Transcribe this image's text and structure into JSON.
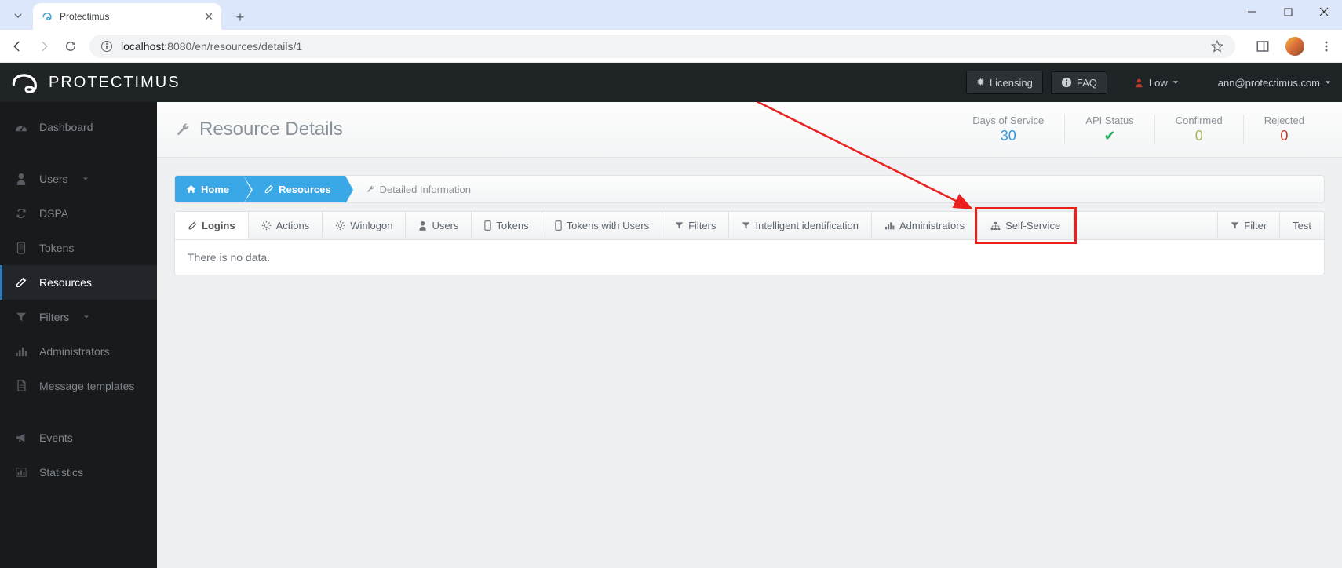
{
  "browser": {
    "tab_title": "Protectimus",
    "url_host": "localhost",
    "url_port": ":8080",
    "url_path": "/en/resources/details/1"
  },
  "topnav": {
    "brand": "PROTECTIMUS",
    "licensing": "Licensing",
    "faq": "FAQ",
    "status_label": "Low",
    "user_email": "ann@protectimus.com"
  },
  "sidebar": {
    "items": [
      {
        "label": "Dashboard"
      },
      {
        "label": "Users"
      },
      {
        "label": "DSPA"
      },
      {
        "label": "Tokens"
      },
      {
        "label": "Resources"
      },
      {
        "label": "Filters"
      },
      {
        "label": "Administrators"
      },
      {
        "label": "Message templates"
      },
      {
        "label": "Events"
      },
      {
        "label": "Statistics"
      }
    ]
  },
  "page": {
    "title": "Resource Details",
    "stats": {
      "days_label": "Days of Service",
      "days_value": "30",
      "api_label": "API Status",
      "confirmed_label": "Confirmed",
      "confirmed_value": "0",
      "rejected_label": "Rejected",
      "rejected_value": "0"
    }
  },
  "crumbs": {
    "home": "Home",
    "resources": "Resources",
    "detail": "Detailed Information"
  },
  "tabs": {
    "logins": "Logins",
    "actions": "Actions",
    "winlogon": "Winlogon",
    "users": "Users",
    "tokens": "Tokens",
    "tokens_users": "Tokens with Users",
    "filters": "Filters",
    "intelligent": "Intelligent identification",
    "administrators": "Administrators",
    "self_service": "Self-Service",
    "filter": "Filter",
    "test": "Test"
  },
  "content": {
    "empty": "There is no data."
  }
}
